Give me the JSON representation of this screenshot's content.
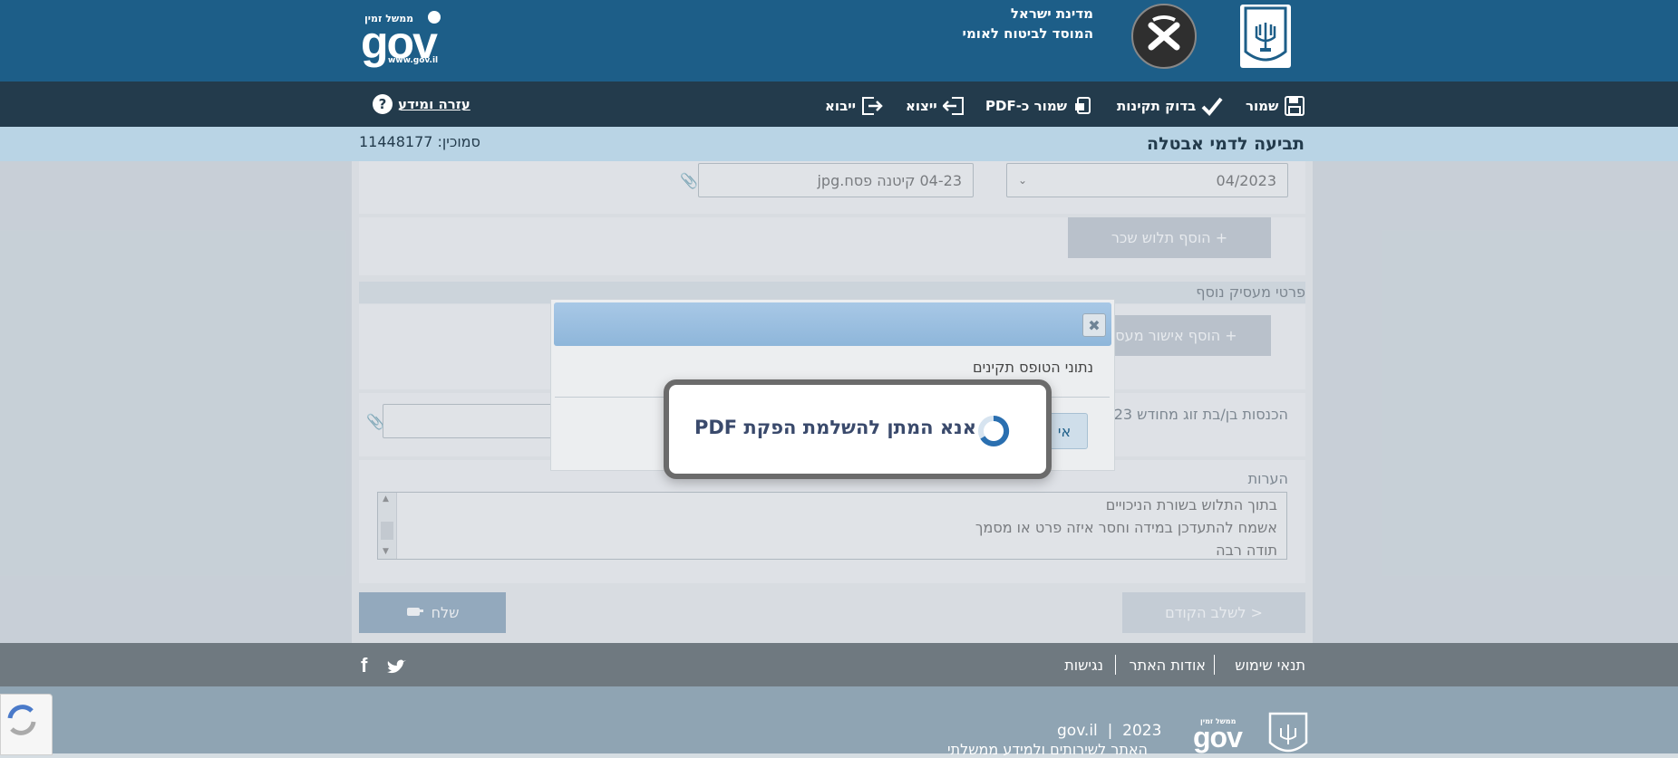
{
  "header": {
    "gov_small": "ממשל זמין",
    "gov_big": "gov",
    "gov_url": "www.gov.il",
    "org_line1": "מדינת ישראל",
    "org_line2": "המוסד לביטוח לאומי"
  },
  "toolbar": {
    "save": "שמור",
    "validate": "בדוק תקינות",
    "save_pdf": "שמור כ-PDF",
    "export": "ייצוא",
    "import": "ייבוא",
    "help": "עזרה ומידע",
    "help_symbol": "?"
  },
  "titlebar": {
    "title": "תביעה לדמי אבטלה",
    "reference": "סמוכין: 11448177"
  },
  "form": {
    "month_value": "04/2023",
    "file_value": "04-23   קיטנה פסח.jpg",
    "add_payslip": "+ הוסף תלוש שכר",
    "extra_employer": "פרטי מעסיק נוסף",
    "add_employer_approval": "+ הוסף אישור מעסיק",
    "spouse_income": "הכנסות בן/בת זוג מחודש 23",
    "notes_label": "הערות",
    "notes_lines": [
      "בתוך התלוש בשורת הניכויים",
      "אשמח להתעדכן במידה וחסר איזה פרט או מסמך",
      "תודה רבה"
    ],
    "send": "שלח",
    "previous": "< לשלב הקודם"
  },
  "footer": {
    "terms": "תנאי שימוש",
    "about": "אודות האתר",
    "accessibility": "נגישות",
    "year": "2023",
    "site": "gov.il",
    "desc": "האתר לשירותים ולמידע ממשלתי"
  },
  "dialog": {
    "close": "✖",
    "message": "נתוני הטופס תקינים",
    "button_partial": "אי"
  },
  "loading": {
    "text": "אנא המתן להשלמת הפקת PDF"
  },
  "colors": {
    "header": "#1d5e88",
    "toolbar": "#233b4c",
    "titlebar": "#b9d4e5"
  }
}
